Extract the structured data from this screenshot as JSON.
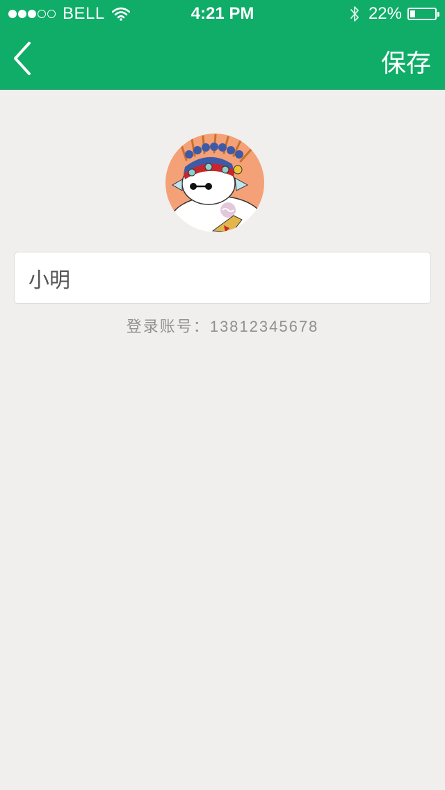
{
  "status_bar": {
    "carrier": "BELL",
    "time": "4:21 PM",
    "battery_pct": "22%",
    "battery_level": 0.22,
    "signal_bars_filled": 3,
    "signal_bars_total": 5
  },
  "nav": {
    "back_icon": "chevron-left-icon",
    "save_label": "保存"
  },
  "profile": {
    "avatar_icon": "user-avatar-cartoon",
    "name_value": "小明",
    "account_text": "登录账号：13812345678"
  },
  "colors": {
    "header": "#0fad68",
    "background": "#f0efed",
    "avatar_bg": "#f4a178"
  }
}
